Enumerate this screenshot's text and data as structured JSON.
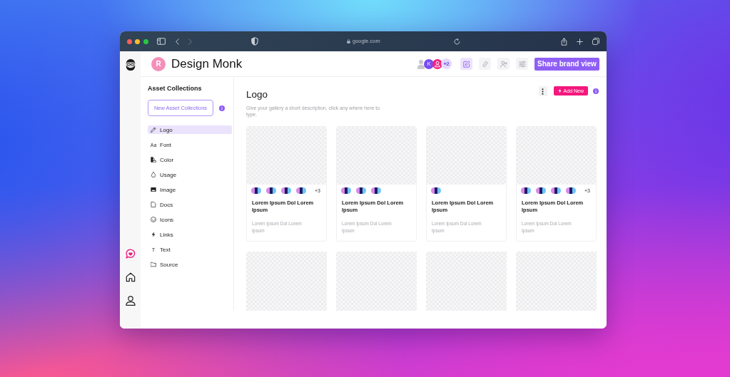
{
  "browser": {
    "url": "google.com"
  },
  "rail": {
    "items": [
      {
        "kind": "chat"
      },
      {
        "kind": "home"
      },
      {
        "kind": "profile"
      }
    ]
  },
  "header": {
    "workspace_initial": "R",
    "title": "Design Monk",
    "collaborators": [
      {
        "kind": "silhouette"
      },
      {
        "kind": "initial",
        "initial": "K",
        "color": "#7a4df3"
      },
      {
        "kind": "person",
        "color": "#f2207e"
      }
    ],
    "collaborators_more": "+2",
    "tools": [
      {
        "kind": "edit",
        "selected": true
      },
      {
        "kind": "link",
        "selected": false
      },
      {
        "kind": "add_user",
        "selected": false
      },
      {
        "kind": "settings",
        "selected": false
      }
    ],
    "share_button": "Share brand view"
  },
  "sidebar": {
    "title": "Asset Collections",
    "new_button": "New Asset Collections",
    "items": [
      {
        "kind": "pencil",
        "label": "Logo",
        "selected": true
      },
      {
        "kind": "glyph",
        "glyph": "Aa",
        "label": "Font",
        "selected": false
      },
      {
        "kind": "color",
        "label": "Color",
        "selected": false
      },
      {
        "kind": "drop",
        "label": "Usage",
        "selected": false
      },
      {
        "kind": "image",
        "label": "Image",
        "selected": false
      },
      {
        "kind": "document",
        "label": "Docs",
        "selected": false
      },
      {
        "kind": "smiley",
        "label": "Icons",
        "selected": false
      },
      {
        "kind": "lightning",
        "label": "Links",
        "selected": false
      },
      {
        "kind": "glyph",
        "glyph": "T",
        "label": "Text",
        "selected": false
      },
      {
        "kind": "folder",
        "label": "Source",
        "selected": false
      }
    ]
  },
  "gallery": {
    "title": "Logo",
    "description": "Give your gallery a short description, click any where here to type.",
    "add_button": "Add New",
    "cards": [
      {
        "kind": "full",
        "swatches": [
          {
            "kind": "palette"
          },
          {
            "kind": "palette"
          },
          {
            "kind": "palette"
          },
          {
            "kind": "palette"
          }
        ],
        "more": "+3",
        "title": "Lorem Ipsum Dol Lorem Ipsum",
        "description": "Lorem Ipsum Dol Lorem Ipsum"
      },
      {
        "kind": "full",
        "swatches": [
          {
            "kind": "palette"
          },
          {
            "kind": "palette"
          },
          {
            "kind": "palette"
          }
        ],
        "title": "Lorem Ipsum Dol Lorem Ipsum",
        "description": "Lorem Ipsum Dol Lorem Ipsum"
      },
      {
        "kind": "full",
        "swatches": [
          {
            "kind": "palette"
          }
        ],
        "title": "Lorem Ipsum Dol Lorem Ipsum",
        "description": "Lorem Ipsum Dol Lorem Ipsum"
      },
      {
        "kind": "full",
        "swatches": [
          {
            "kind": "palette"
          },
          {
            "kind": "palette"
          },
          {
            "kind": "palette"
          },
          {
            "kind": "palette"
          }
        ],
        "more": "+3",
        "title": "Lorem Ipsum Dol Lorem Ipsum",
        "description": "Lorem Ipsum Dol Lorem Ipsum"
      },
      {
        "kind": "image_only"
      },
      {
        "kind": "image_only"
      },
      {
        "kind": "image_only"
      },
      {
        "kind": "image_only"
      }
    ]
  }
}
